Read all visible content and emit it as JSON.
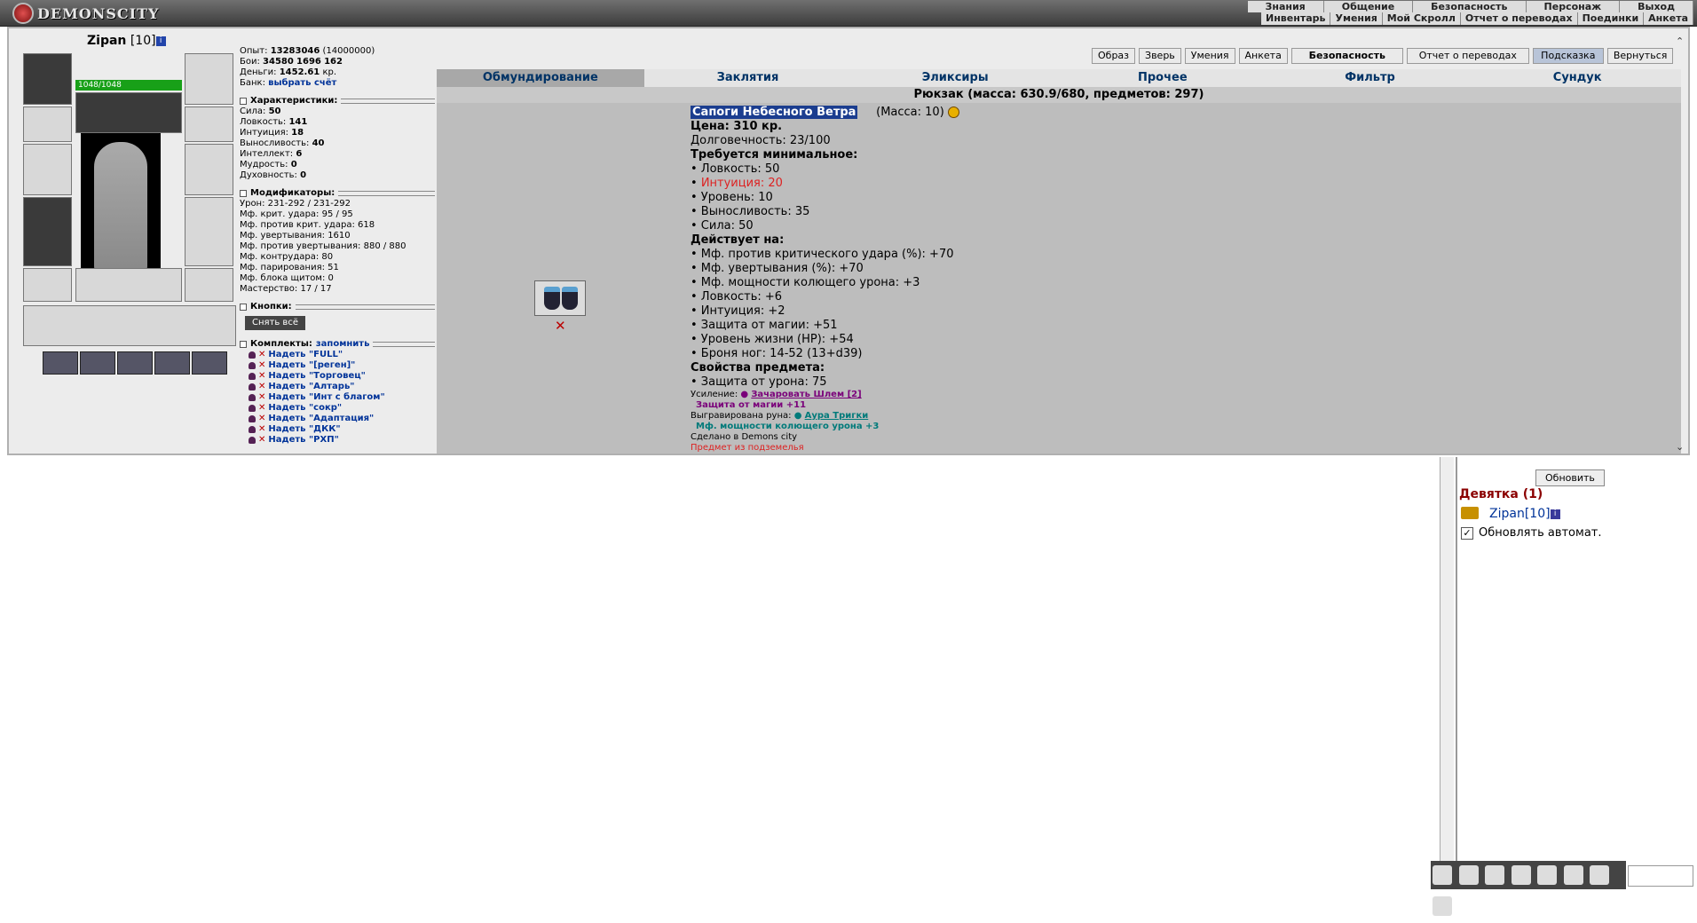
{
  "topbar": {
    "logo_text": "DEMONSCITY",
    "menu_main": [
      "Знания",
      "Общение",
      "Безопасность",
      "Персонаж",
      "Выход"
    ],
    "menu_sub": [
      "Инвентарь",
      "Умения",
      "Мой Скролл",
      "Отчет о переводах",
      "Поединки",
      "Анкета"
    ]
  },
  "character": {
    "name": "Zipan",
    "level": "[10]",
    "info_icon": "i",
    "hp": "1048/1048"
  },
  "stats": {
    "exp_label": "Опыт:",
    "exp_value": "13283046",
    "exp_next": "(14000000)",
    "fights_label": "Бои:",
    "wins": "34580",
    "losses": "1696",
    "draws": "162",
    "money_label": "Деньги:",
    "money_value": "1452.61",
    "money_unit": "кр.",
    "bank_label": "Банк:",
    "bank_link": "выбрать счёт",
    "characteristics_title": "Характеристики:",
    "characteristics": [
      {
        "label": "Сила:",
        "value": "50"
      },
      {
        "label": "Ловкость:",
        "value": "141"
      },
      {
        "label": "Интуиция:",
        "value": "18"
      },
      {
        "label": "Выносливость:",
        "value": "40"
      },
      {
        "label": "Интеллект:",
        "value": "6"
      },
      {
        "label": "Мудрость:",
        "value": "0"
      },
      {
        "label": "Духовность:",
        "value": "0"
      }
    ],
    "modifiers_title": "Модификаторы:",
    "modifiers": [
      "Урон: 231-292 / 231-292",
      "Мф. крит. удара: 95 / 95",
      "Мф. против крит. удара: 618",
      "Мф. увертывания: 1610",
      "Мф. против увертывания: 880 / 880",
      "Мф. контрудара: 80",
      "Мф. парирования: 51",
      "Мф. блока щитом: 0",
      "Мастерство: 17 / 17"
    ],
    "buttons_title": "Кнопки:",
    "unequip_all": "Снять всё",
    "kits_title": "Комплекты:",
    "kits_remember": "запомнить",
    "kits": [
      "Надеть \"FULL\"",
      "Надеть \"[реген]\"",
      "Надеть \"Торговец\"",
      "Надеть \"Алтарь\"",
      "Надеть \"Инт с благом\"",
      "Надеть \"сокр\"",
      "Надеть \"Адаптация\"",
      "Надеть \"ДКК\"",
      "Надеть \"РХП\""
    ]
  },
  "nav_buttons": [
    "Образ",
    "Зверь",
    "Умения",
    "Анкета",
    "Безопасность",
    "Отчет о переводах",
    "Подсказка",
    "Вернуться"
  ],
  "tabs": [
    "Обмундирование",
    "Заклятия",
    "Эликсиры",
    "Прочее",
    "Фильтр",
    "Сундук"
  ],
  "backpack": "Рюкзак (масса: 630.9/680, предметов: 297)",
  "item": {
    "name": "Сапоги Небесного Ветра",
    "mass": "(Масса: 10)",
    "price": "Цена: 310 кр.",
    "durability": "Долговечность: 23/100",
    "req_title": "Требуется минимальное:",
    "requirements": [
      "• Ловкость: 50"
    ],
    "req_fail": "Интуиция: 20",
    "requirements2": [
      "• Уровень: 10",
      "• Выносливость: 35",
      "• Сила: 50"
    ],
    "effects_title": "Действует на:",
    "effects": [
      "• Мф. против критического удара (%): +70",
      "• Мф. увертывания (%): +70",
      "• Мф. мощности колющего урона: +3",
      "• Ловкость: +6",
      "• Интуиция: +2",
      "• Защита от магии: +51",
      "• Уровень жизни (HP): +54",
      "• Броня ног: 14-52 (13+d39)"
    ],
    "props_title": "Свойства предмета:",
    "props": [
      "• Защита от урона: 75"
    ],
    "upgrade_label": "Усиление:",
    "upgrade_link": "Зачаровать Шлем [2]",
    "upgrade_effect": "Защита от магии +11",
    "rune_label": "Выгравирована руна:",
    "rune_link": "Аура Тригки",
    "rune_effect": "Мф. мощности колющего урона +3",
    "made_in": "Сделано в Demons city",
    "partial_line": "Предмет из подземелья"
  },
  "chat_panel": {
    "refresh_button": "Обновить",
    "room": "Девятка (1)",
    "user_name": "Zipan",
    "user_level": "[10]",
    "user_info": "i",
    "auto_refresh_label": "Обновлять автомат.",
    "auto_refresh_checked": "✓"
  }
}
